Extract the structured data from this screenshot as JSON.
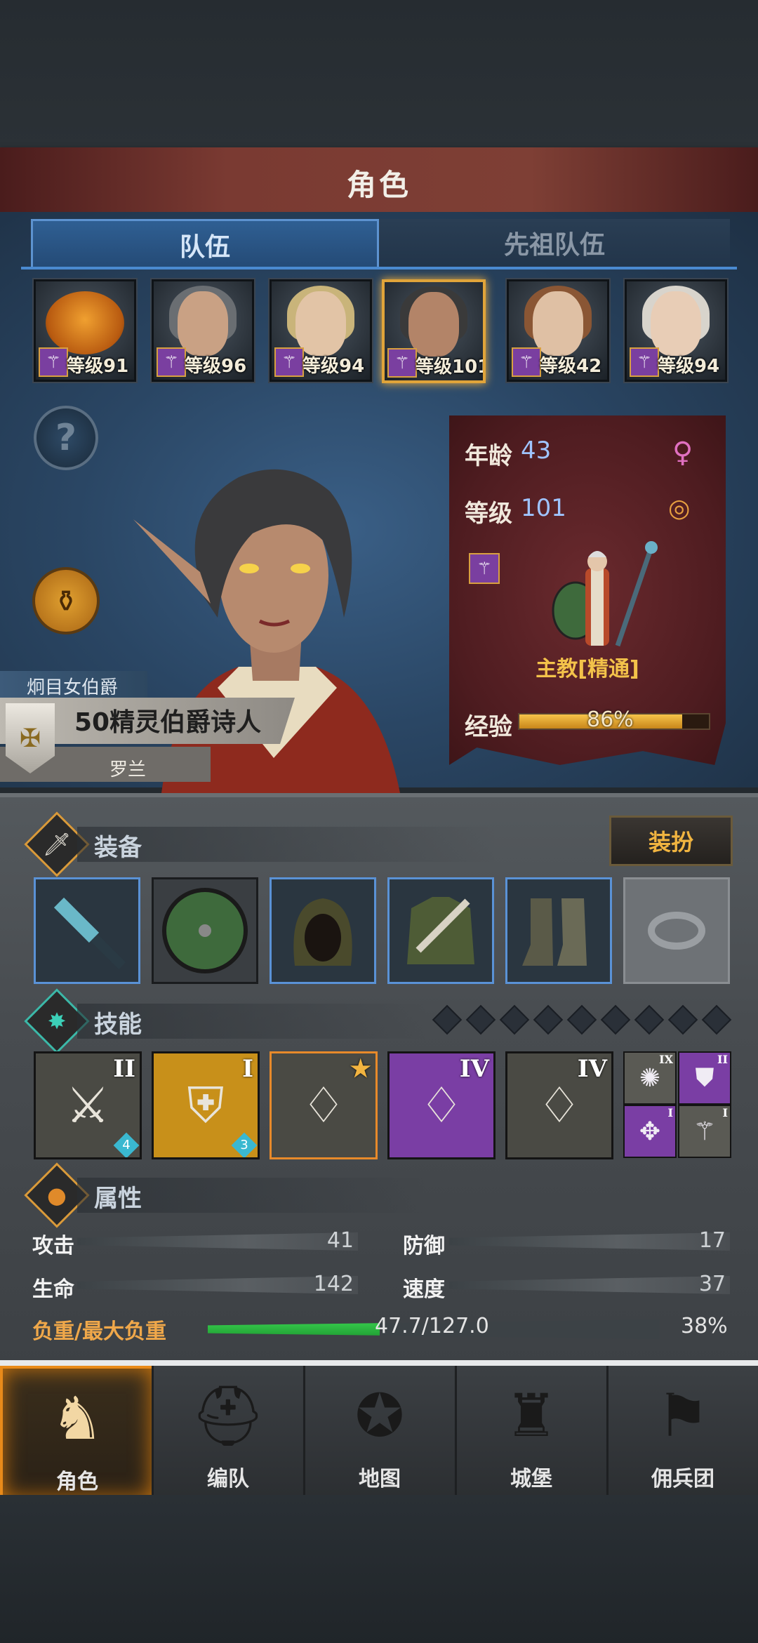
{
  "header": {
    "title": "角色"
  },
  "tabs": {
    "team": "队伍",
    "ancestor": "先祖队伍"
  },
  "roster": [
    {
      "level": "等级91",
      "selected": false
    },
    {
      "level": "等级96",
      "selected": false
    },
    {
      "level": "等级94",
      "selected": false
    },
    {
      "level": "等级101",
      "selected": true
    },
    {
      "level": "等级42",
      "selected": false
    },
    {
      "level": "等级94",
      "selected": false
    }
  ],
  "help_glyph": "?",
  "character": {
    "title": "炯目女伯爵",
    "name": "50精灵伯爵诗人",
    "subtitle": "罗兰",
    "age_label": "年龄",
    "age": "43",
    "level_label": "等级",
    "level": "101",
    "class_name": "主教[精通]",
    "exp_label": "经验",
    "exp_text": "86%",
    "exp_fraction": 0.86,
    "gender_icon": "female-symbol",
    "accent": "#f3c24a"
  },
  "equipment": {
    "title": "装备",
    "dress_button": "装扮",
    "slots": [
      "mace",
      "round-shield",
      "hood",
      "tunic",
      "boots",
      "ring-empty"
    ]
  },
  "skills": {
    "title": "技能",
    "points": 9,
    "main": [
      {
        "numeral": "II",
        "gem": "4"
      },
      {
        "numeral": "I",
        "gem": "3"
      },
      {
        "numeral": "",
        "gem": ""
      },
      {
        "numeral": "IV",
        "gem": ""
      },
      {
        "numeral": "IV",
        "gem": ""
      }
    ],
    "minor": [
      {
        "numeral": "IX"
      },
      {
        "numeral": "II"
      },
      {
        "numeral": "I"
      },
      {
        "numeral": "I"
      }
    ]
  },
  "attributes": {
    "title": "属性",
    "attack_label": "攻击",
    "attack": "41",
    "defense_label": "防御",
    "defense": "17",
    "hp_label": "生命",
    "hp": "142",
    "speed_label": "速度",
    "speed": "37",
    "load_label": "负重/最大负重",
    "load_text": "47.7/127.0",
    "load_pct": "38%",
    "load_fraction": 0.38
  },
  "nav": {
    "character": "角色",
    "formation": "编队",
    "map": "地图",
    "castle": "城堡",
    "mercenary": "佣兵团"
  }
}
